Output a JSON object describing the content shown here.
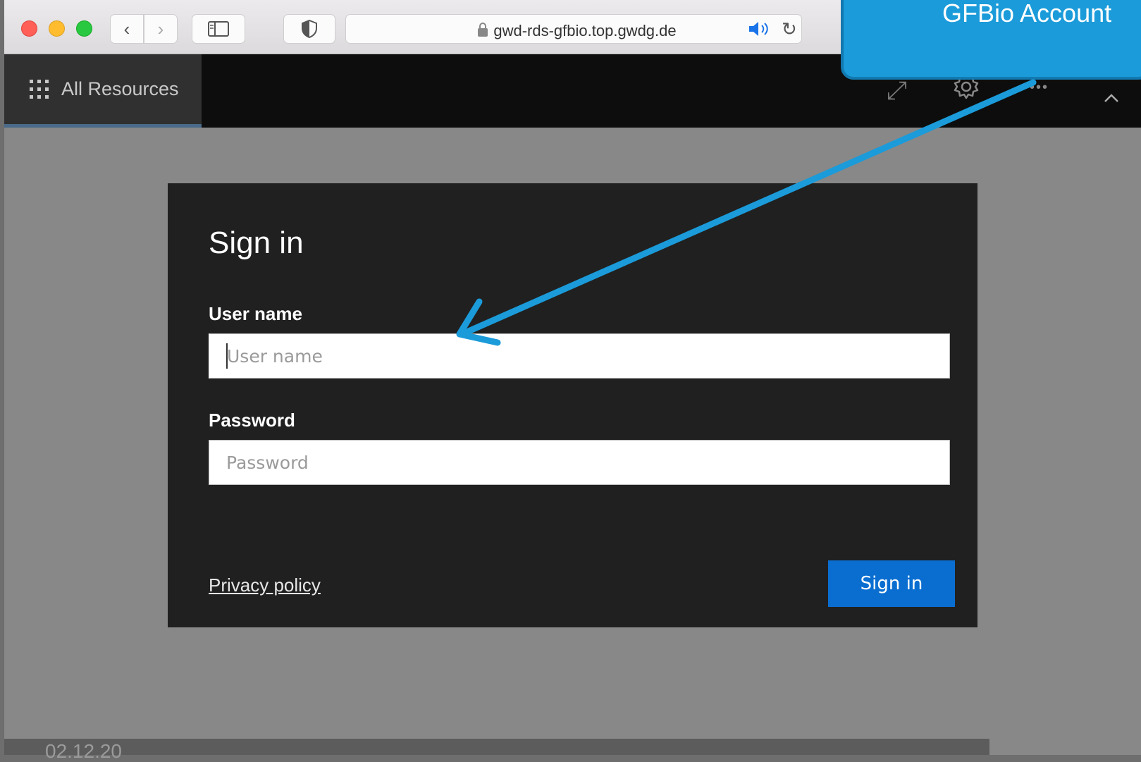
{
  "browser": {
    "url": "gwd-rds-gfbio.top.gwdg.de"
  },
  "appbar": {
    "all_resources_label": "All Resources"
  },
  "dialog": {
    "title": "Sign in",
    "username_label": "User name",
    "username_placeholder": "User name",
    "username_value": "",
    "password_label": "Password",
    "password_placeholder": "Password",
    "password_value": "",
    "privacy_link": "Privacy policy",
    "signin_button": "Sign in"
  },
  "footer": {
    "date": "02.12.20"
  },
  "annotation": {
    "callout_text": "GFBio Account",
    "accent_color": "#1b9bd9"
  },
  "colors": {
    "signin_button": "#0a6ed1",
    "dialog_bg": "#202020",
    "appbar_bg": "#0d0d0d"
  }
}
